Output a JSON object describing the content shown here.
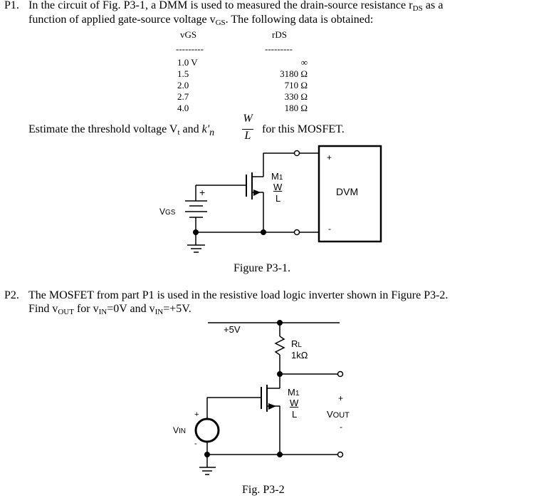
{
  "p1": {
    "number": "P1.",
    "line1": "In the circuit of Fig. P3-1, a DMM is used to measured the drain-source resistance r",
    "line1_sub": "DS",
    "line1_end": " as a",
    "line2": "function of applied gate-source voltage v",
    "line2_sub": "GS",
    "line2_end": ".  The following data is obtained:",
    "table": {
      "headers": [
        {
          "main": "v",
          "sub": "GS"
        },
        {
          "main": "r",
          "sub": "DS"
        }
      ],
      "rule": "---------",
      "rows": [
        {
          "vgs": "1.0 V",
          "rds": "∞"
        },
        {
          "vgs": "1.5",
          "rds": "3180 Ω"
        },
        {
          "vgs": "2.0",
          "rds": "710 Ω"
        },
        {
          "vgs": "2.7",
          "rds": "330 Ω"
        },
        {
          "vgs": "4.0",
          "rds": "180 Ω"
        }
      ]
    },
    "estimate_start": "Estimate the threshold voltage V",
    "estimate_sub": "t",
    "estimate_mid": " and ",
    "k_prime": "k'",
    "k_sub": "n",
    "frac_num": "W",
    "frac_den": "L",
    "estimate_end": "for this MOSFET."
  },
  "figure1": {
    "caption": "Figure P3-1.",
    "source_label": "V",
    "source_label_sub": "GS",
    "plus": "+",
    "minus": "-",
    "transistor": {
      "name": "M",
      "index": "1",
      "w": "W",
      "l": "L"
    },
    "meter": {
      "label": "DVM",
      "plus": "+",
      "minus": "-"
    }
  },
  "p2": {
    "number": "P2.",
    "line1": "The MOSFET from part P1 is used in the resistive load logic inverter shown in Figure P3-2.",
    "line2_a": "Find v",
    "line2_sub1": "OUT",
    "line2_b": " for v",
    "line2_sub2": "IN",
    "line2_c": "=0V and v",
    "line2_sub3": "IN",
    "line2_d": "=+5V."
  },
  "figure2": {
    "caption": "Fig. P3-2",
    "supply": "+5V",
    "resistor": {
      "name": "R",
      "sub": "L",
      "value": "1kΩ"
    },
    "transistor": {
      "name": "M",
      "index": "1",
      "w": "W",
      "l": "L"
    },
    "vin": {
      "label": "V",
      "sub": "IN",
      "plus": "+",
      "minus": "-"
    },
    "vout": {
      "label": "V",
      "sub": "OUT",
      "plus": "+",
      "minus": "-"
    }
  }
}
